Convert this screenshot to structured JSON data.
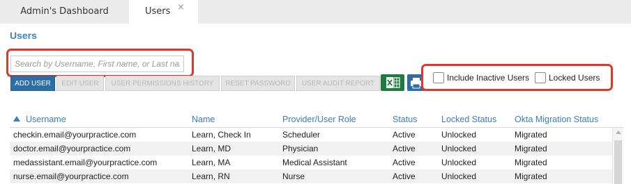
{
  "tabs": [
    {
      "label": "Admin's Dashboard",
      "active": false
    },
    {
      "label": "Users",
      "active": true,
      "close": "×"
    }
  ],
  "page": {
    "title": "Users"
  },
  "search": {
    "placeholder": "Search by Username, First name, or Last name",
    "value": ""
  },
  "toolbar": {
    "add_user": "ADD USER",
    "edit_user": "EDIT USER",
    "user_permissions_history": "USER PERMISSIONS HISTORY",
    "reset_password": "RESET PASSWORD",
    "user_audit_report": "USER AUDIT REPORT",
    "excel_icon": "excel-export-icon",
    "print_icon": "print-icon"
  },
  "filters": {
    "include_inactive": {
      "label": "Include Inactive Users",
      "checked": false
    },
    "locked_users": {
      "label": "Locked Users",
      "checked": false
    }
  },
  "table": {
    "sort": {
      "column": "Username",
      "direction": "ascending"
    },
    "columns": [
      "Username",
      "Name",
      "Provider/User Role",
      "Status",
      "Locked Status",
      "Okta Migration Status"
    ],
    "rows": [
      {
        "username": "checkin.email@yourpractice.com",
        "name": "Learn, Check In",
        "role": "Scheduler",
        "status": "Active",
        "locked": "Unlocked",
        "okta": "Migrated"
      },
      {
        "username": "doctor.email@yourpractice.com",
        "name": "Learn, MD",
        "role": "Physician",
        "status": "Active",
        "locked": "Unlocked",
        "okta": "Migrated"
      },
      {
        "username": "medassistant.email@yourpractice.com",
        "name": "Learn, MA",
        "role": "Medical Assistant",
        "status": "Active",
        "locked": "Unlocked",
        "okta": "Migrated"
      },
      {
        "username": "nurse.email@yourpractice.com",
        "name": "Learn, RN",
        "role": "Nurse",
        "status": "Active",
        "locked": "Unlocked",
        "okta": "Migrated"
      }
    ]
  },
  "colors": {
    "accent": "#3a86c4",
    "primary_button": "#2c6fa8",
    "excel_green": "#1f7a3f",
    "highlight_red": "#e0372b"
  }
}
